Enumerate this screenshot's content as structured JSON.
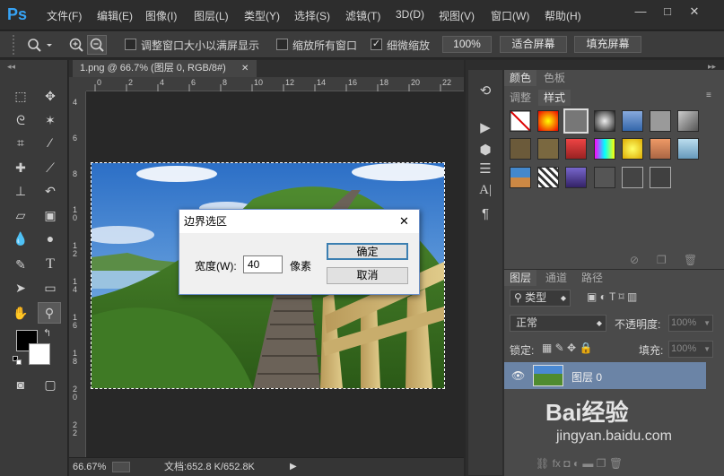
{
  "app": {
    "logo": "Ps"
  },
  "menu": [
    "文件(F)",
    "编辑(E)",
    "图像(I)",
    "图层(L)",
    "类型(Y)",
    "选择(S)",
    "滤镜(T)",
    "3D(D)",
    "视图(V)",
    "窗口(W)",
    "帮助(H)"
  ],
  "window_controls": {
    "minimize": "—",
    "restore": "□",
    "close": "✕"
  },
  "options": {
    "resize_windows_label": "调整窗口大小以满屏显示",
    "resize_windows_checked": false,
    "zoom_all_label": "缩放所有窗口",
    "zoom_all_checked": false,
    "scrubby_zoom_label": "细微缩放",
    "scrubby_zoom_checked": true,
    "btn_100": "100%",
    "btn_fit": "适合屏幕",
    "btn_fill": "填充屏幕"
  },
  "document": {
    "tab_title": "1.png @ 66.7% (图层 0, RGB/8#)",
    "close_glyph": "✕",
    "zoom": "66.67%",
    "doc_size": "文档:652.8 K/652.8K",
    "ruler_h": [
      "0",
      "2",
      "4",
      "6",
      "8",
      "10",
      "12",
      "14",
      "16",
      "18",
      "20",
      "22"
    ],
    "ruler_v": [
      "4",
      "6",
      "8",
      "1\n0",
      "1\n2",
      "1\n4",
      "1\n6",
      "1\n8",
      "2\n0",
      "2\n2"
    ]
  },
  "panels": {
    "color_tab": "颜色",
    "swatches_tab": "色板",
    "adjust_tab": "调整",
    "styles_tab": "样式",
    "layers_tab": "图层",
    "channels_tab": "通道",
    "paths_tab": "路径",
    "filter_kind": "类型",
    "blend_mode": "正常",
    "opacity_label": "不透明度:",
    "opacity_value": "100%",
    "lock_label": "锁定:",
    "fill_label": "填充:",
    "fill_value": "100%",
    "layer_name": "图层 0"
  },
  "dialog": {
    "title": "边界选区",
    "width_label": "宽度(W):",
    "width_value": "40",
    "unit": "像素",
    "ok": "确定",
    "cancel": "取消",
    "close_glyph": "✕"
  },
  "watermark": {
    "text": "Bai经验",
    "url": "jingyan.baidu.com"
  },
  "colors": {
    "accent": "#36a3f5",
    "dialog_border": "#6a8fc9",
    "layer_selected": "#6b84a6"
  }
}
